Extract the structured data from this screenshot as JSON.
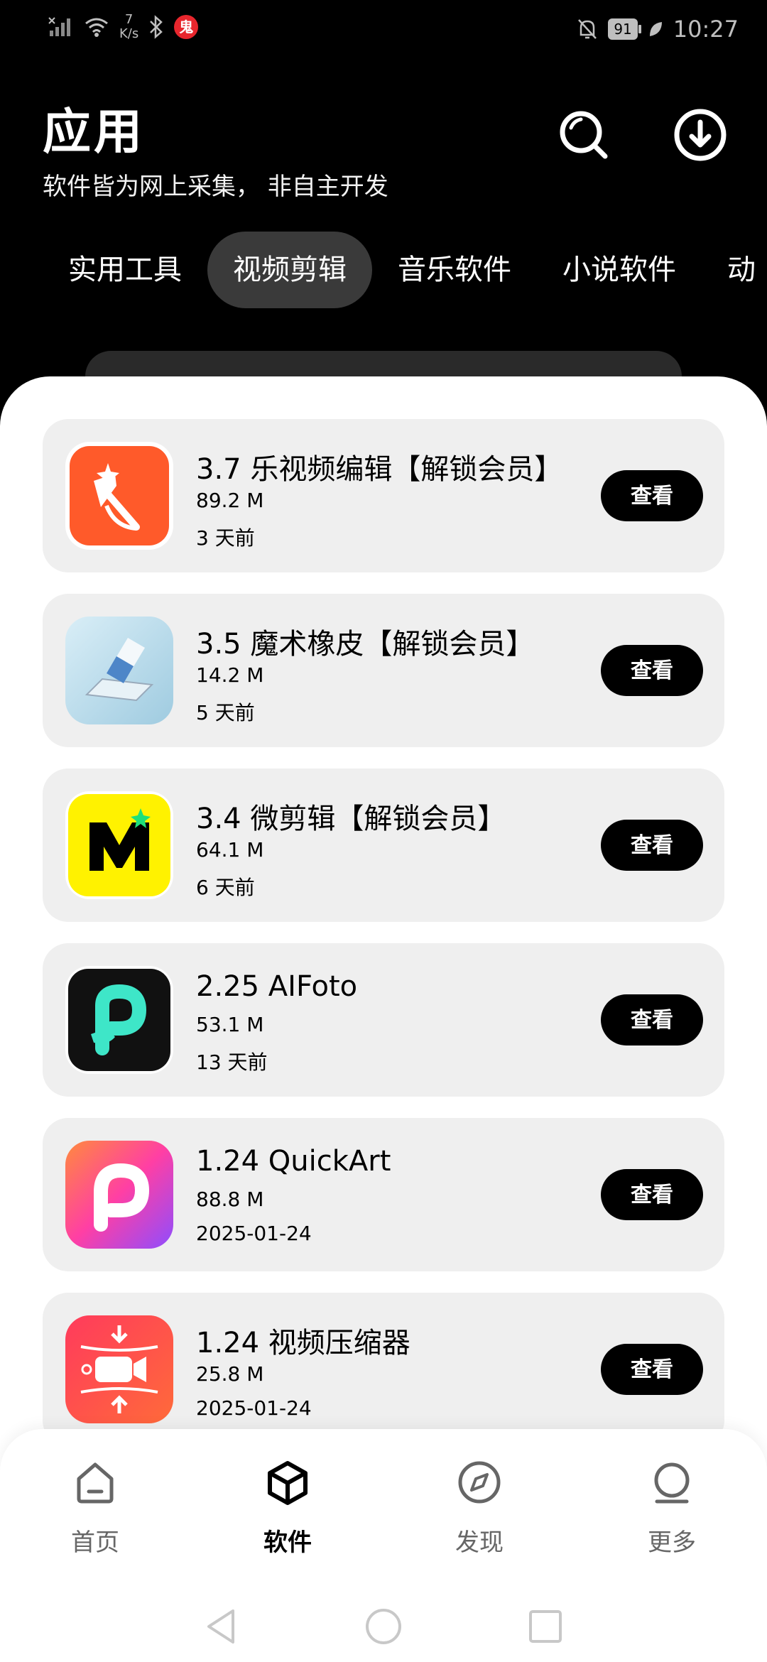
{
  "status_bar": {
    "net_speed_value": "7",
    "net_speed_unit": "K/s",
    "badge": "鬼",
    "battery": "91",
    "time": "10:27"
  },
  "header": {
    "title": "应用",
    "subtitle": "软件皆为网上采集， 非自主开发"
  },
  "tabs": [
    {
      "label": "实用工具"
    },
    {
      "label": "视频剪辑"
    },
    {
      "label": "音乐软件"
    },
    {
      "label": "小说软件"
    },
    {
      "label": "动"
    }
  ],
  "apps": [
    {
      "name": "3.7  乐视频编辑【解锁会员】",
      "size": "89.2 M",
      "date": "3 天前",
      "action": "查看",
      "icon": "video-editor-icon"
    },
    {
      "name": "3.5   魔术橡皮【解锁会员】",
      "size": "14.2 M",
      "date": "5 天前",
      "action": "查看",
      "icon": "magic-eraser-icon"
    },
    {
      "name": "3.4   微剪辑【解锁会员】",
      "size": "64.1 M",
      "date": "6 天前",
      "action": "查看",
      "icon": "micro-edit-icon"
    },
    {
      "name": "2.25   AIFoto",
      "size": "53.1 M",
      "date": "13 天前",
      "action": "查看",
      "icon": "aifoto-icon"
    },
    {
      "name": "1.24   QuickArt",
      "size": "88.8 M",
      "date": "2025-01-24",
      "action": "查看",
      "icon": "quickart-icon"
    },
    {
      "name": "1.24  视频压缩器",
      "size": "25.8 M",
      "date": "2025-01-24",
      "action": "查看",
      "icon": "video-compressor-icon"
    }
  ],
  "nav": [
    {
      "label": "首页",
      "icon": "home-icon"
    },
    {
      "label": "软件",
      "icon": "cube-icon"
    },
    {
      "label": "发现",
      "icon": "compass-icon"
    },
    {
      "label": "更多",
      "icon": "more-icon"
    }
  ],
  "colors": {
    "background": "#000000",
    "tab_active": "#3a3a3a",
    "card": "#efefef",
    "button": "#000000"
  }
}
